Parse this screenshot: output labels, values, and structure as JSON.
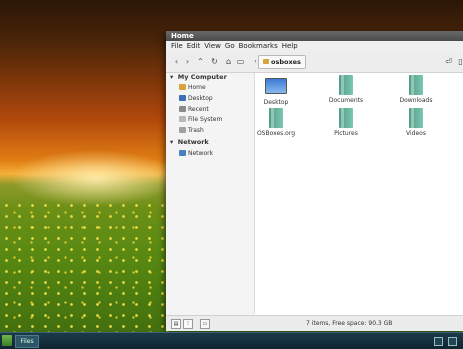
{
  "window": {
    "title": "Home"
  },
  "menubar": [
    "File",
    "Edit",
    "View",
    "Go",
    "Bookmarks",
    "Help"
  ],
  "toolbar": {
    "back_icon": "chevron-left-icon",
    "forward_icon": "chevron-right-icon",
    "up_icon": "chevron-up-icon",
    "reload_icon": "reload-icon",
    "home_icon": "home-icon",
    "computer_icon": "computer-icon",
    "breadcrumb": "osboxes"
  },
  "sidebar": {
    "sections": [
      {
        "title": "My Computer",
        "items": [
          {
            "label": "Home",
            "icon": "home-icon"
          },
          {
            "label": "Desktop",
            "icon": "desktop-icon"
          },
          {
            "label": "Recent",
            "icon": "recent-icon"
          },
          {
            "label": "File System",
            "icon": "drive-icon"
          },
          {
            "label": "Trash",
            "icon": "trash-icon"
          }
        ]
      },
      {
        "title": "Network",
        "items": [
          {
            "label": "Network",
            "icon": "network-icon"
          }
        ]
      }
    ]
  },
  "files": [
    {
      "name": "Desktop",
      "type": "desktop"
    },
    {
      "name": "Documents",
      "type": "folder"
    },
    {
      "name": "Downloads",
      "type": "folder"
    },
    {
      "name": "OSBoxes.org",
      "type": "folder"
    },
    {
      "name": "Pictures",
      "type": "folder"
    },
    {
      "name": "Videos",
      "type": "folder"
    }
  ],
  "statusbar": {
    "text": "7 items, Free space: 90.3 GB"
  },
  "taskbar": {
    "task_label": "Files"
  },
  "colors": {
    "folder": "#5fb09a",
    "panel": "#0f2531",
    "titlebar": "#4a4a4a"
  }
}
